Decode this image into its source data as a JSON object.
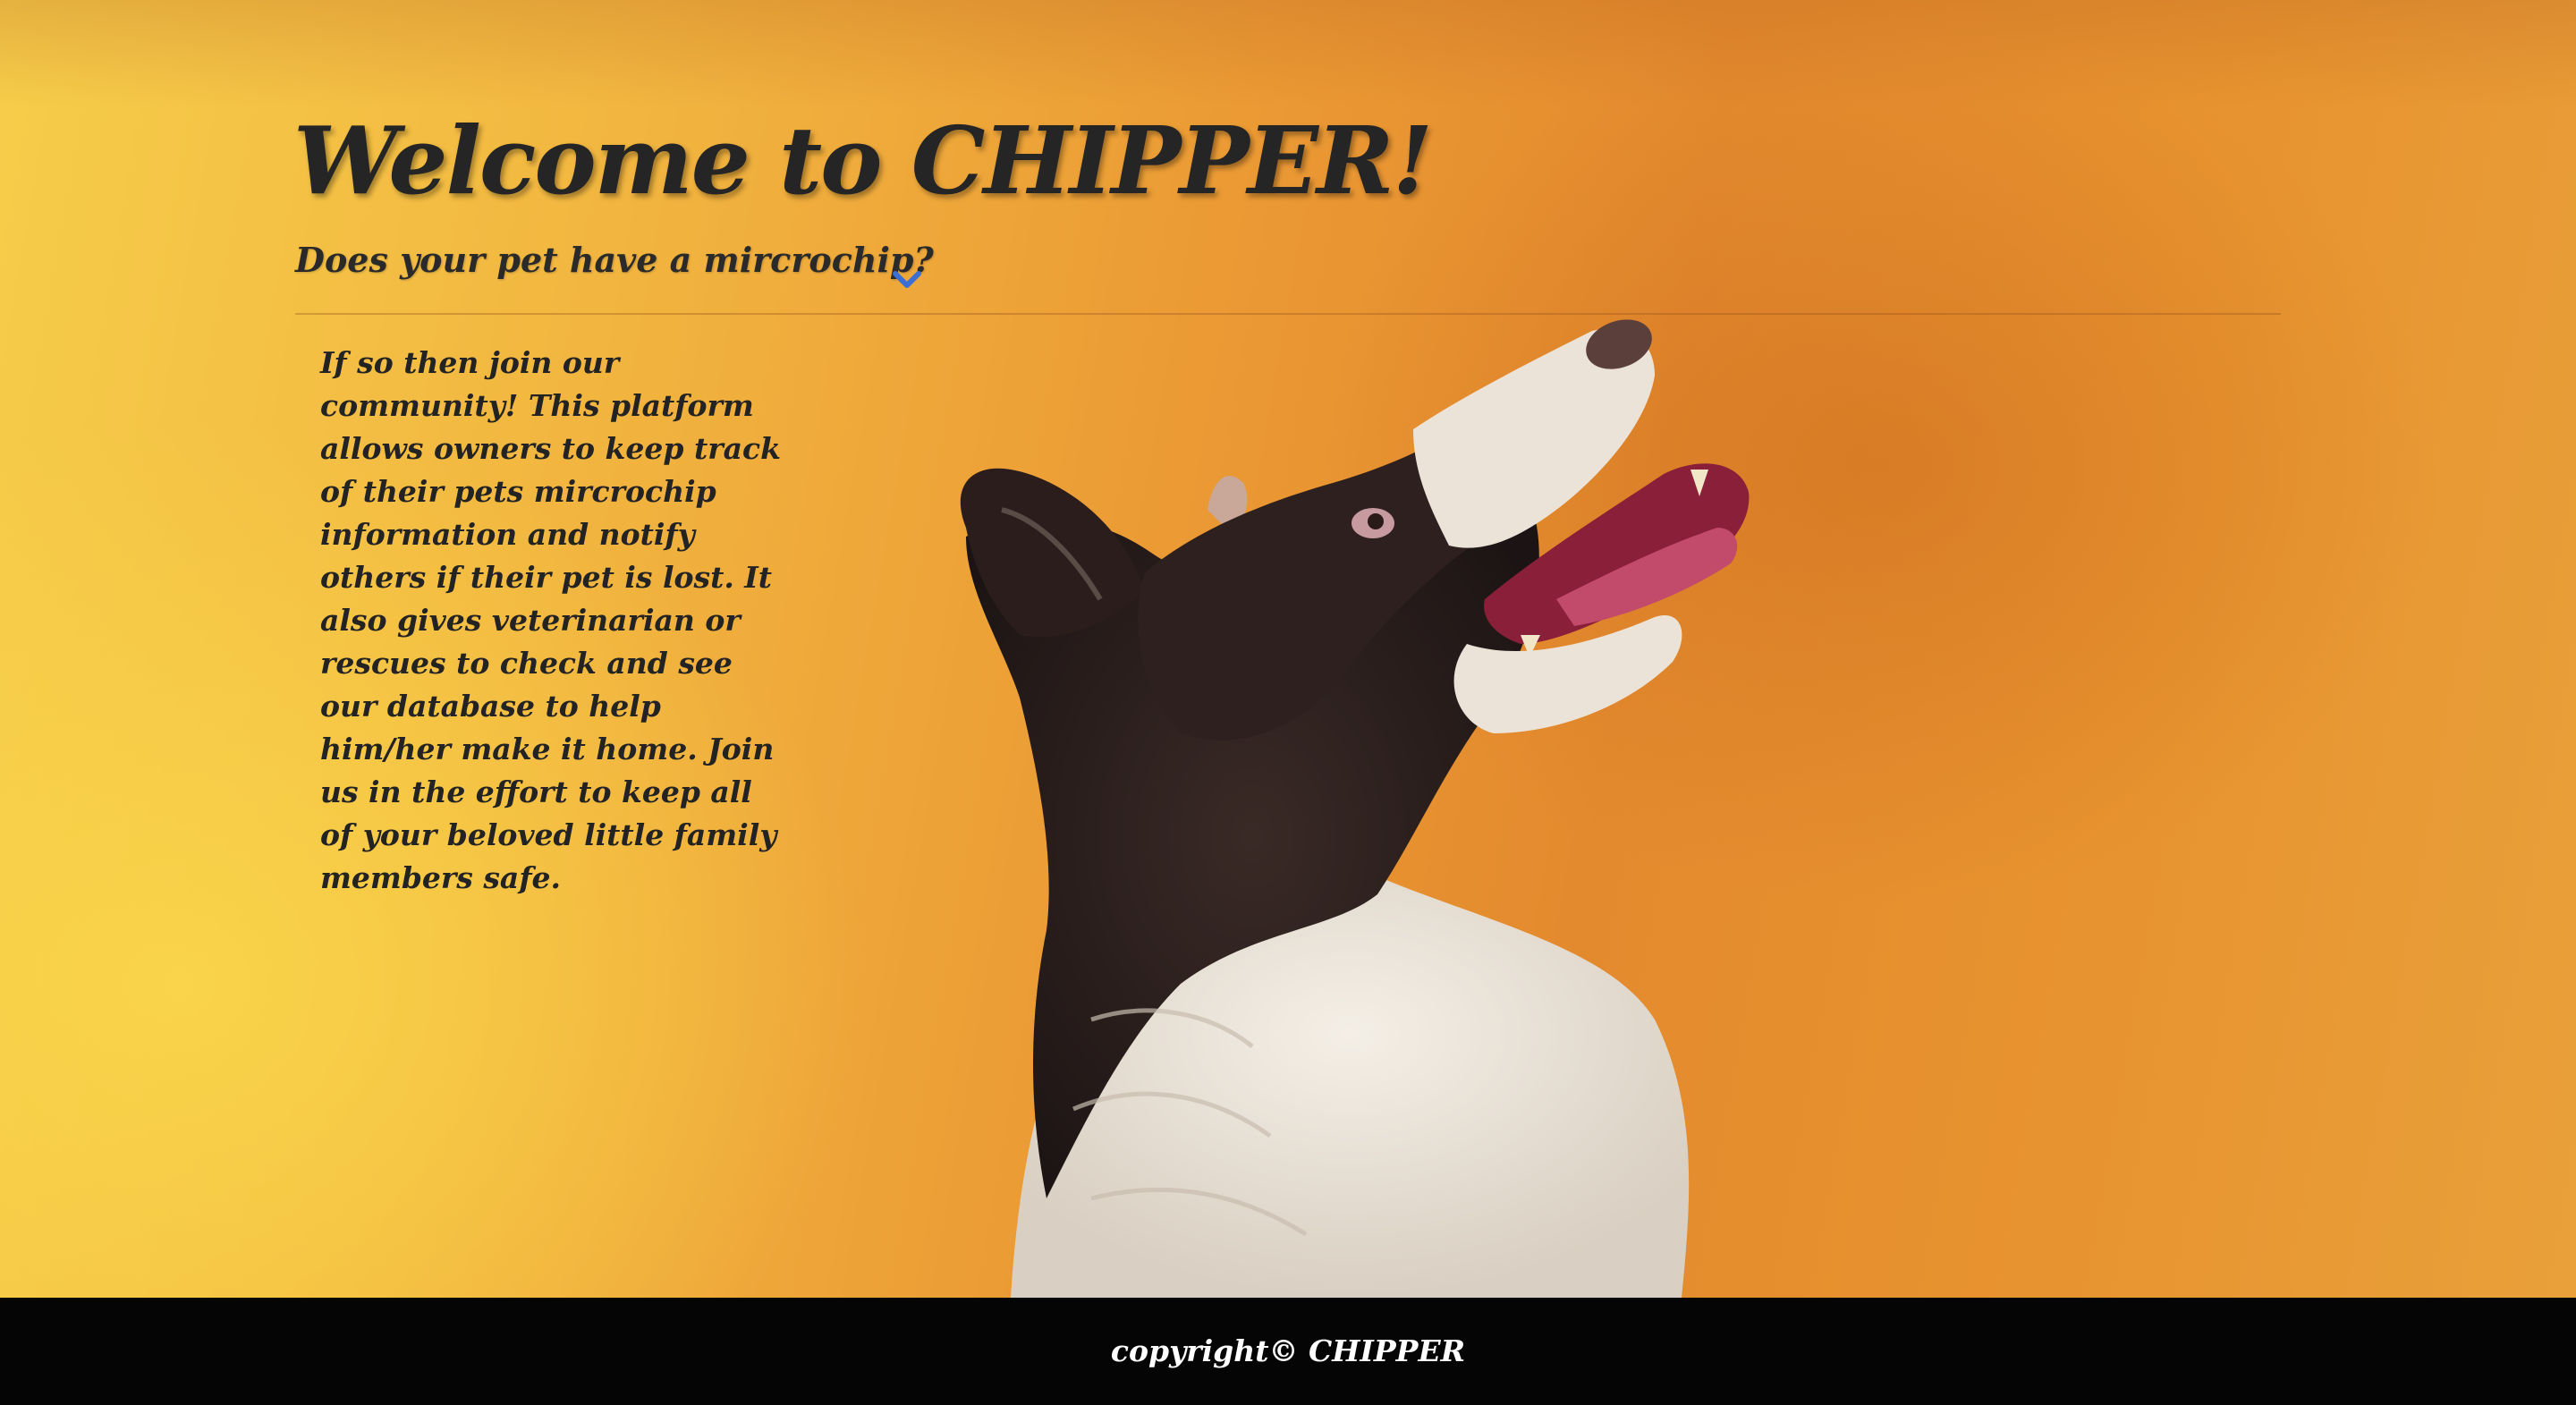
{
  "header": {
    "title": "Welcome to CHIPPER!",
    "subtitle": "Does your pet have a mircrochip?",
    "expand_icon": "chevron-down-icon"
  },
  "main": {
    "description": "If so then join our community! This platform allows owners to keep track of their pets mircrochip information and notify others if their pet is lost. It also gives veterinarian or rescues to check and see our database to help him/her make it home. Join us in the effort to keep all of your beloved little family members safe.",
    "hero_image": "dog-photo"
  },
  "footer": {
    "copyright": "copyright© CHIPPER"
  },
  "colors": {
    "background_light": "#f6cd4a",
    "background_dark": "#e38a2e",
    "text": "#252525",
    "accent_chevron": "#3b6fd4",
    "footer_bg": "#050505",
    "footer_text": "#ffffff"
  }
}
